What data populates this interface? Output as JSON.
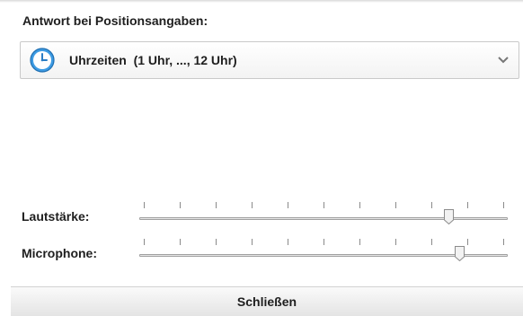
{
  "section_label": "Antwort bei Positionsangaben:",
  "combo": {
    "icon": "clock-icon",
    "selected": "Uhrzeiten  (1 Uhr, ..., 12 Uhr)"
  },
  "volume": {
    "label": "Lautstärke:",
    "value_fraction": 0.84
  },
  "microphone": {
    "label": "Microphone:",
    "value_fraction": 0.87
  },
  "close_label": "Schließen",
  "colors": {
    "clock_blue": "#2f8fd8",
    "button_text": "#1e1e1e"
  }
}
